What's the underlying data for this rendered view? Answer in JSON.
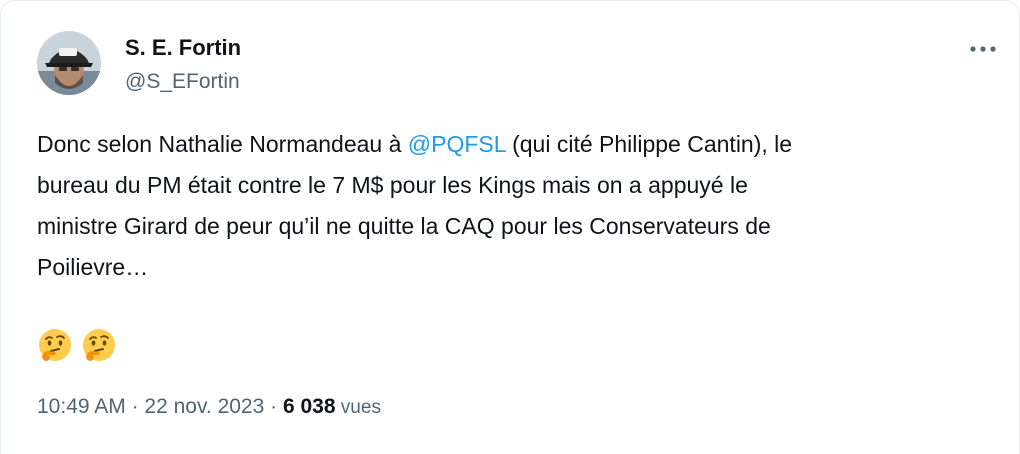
{
  "author": {
    "display_name": "S. E. Fortin",
    "handle": "@S_EFortin",
    "avatar_icon": "profile-photo-avatar"
  },
  "menu": {
    "icon": "more-horizontal-icon"
  },
  "tweet": {
    "lines": [
      {
        "before": "Donc selon Nathalie Normandeau à ",
        "mention": "@PQFSL",
        "after": " (qui cité Philippe Cantin), le"
      },
      {
        "text": "bureau du PM était contre le 7 M$ pour les Kings mais on a appuyé le"
      },
      {
        "text": "ministre Girard de peur qu’il ne quitte la CAQ pour les Conservateurs de"
      },
      {
        "text": "Poilievre…"
      }
    ],
    "emojis": [
      "thinking-face-emoji",
      "thinking-face-emoji"
    ]
  },
  "meta": {
    "time": "10:49 AM",
    "separator": " · ",
    "date": "22 nov. 2023",
    "views_count": "6 038",
    "views_label": " vues"
  },
  "colors": {
    "text": "#0f1419",
    "secondary": "#536471",
    "link": "#1d9bf0",
    "border": "#e6ecf0"
  }
}
